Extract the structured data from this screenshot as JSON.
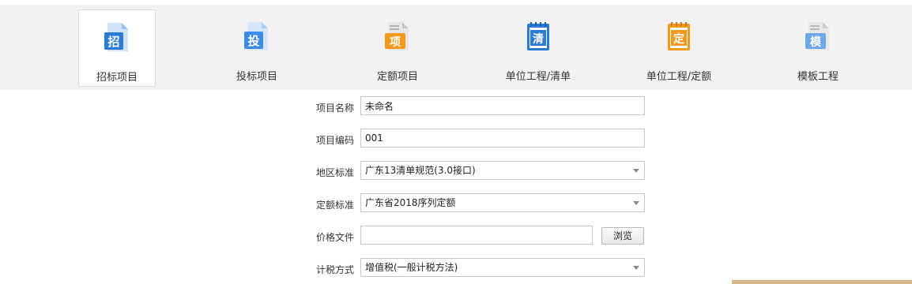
{
  "toolbar": {
    "items": [
      {
        "label": "招标项目",
        "icon_char": "招",
        "icon": "bid-invite-icon",
        "color": "#2a7ad6",
        "active": true
      },
      {
        "label": "投标项目",
        "icon_char": "投",
        "icon": "bid-submit-icon",
        "color": "#3d8be8",
        "active": false
      },
      {
        "label": "定额项目",
        "icon_char": "项",
        "icon": "quota-project-icon",
        "color": "#f39a1e",
        "active": false
      },
      {
        "label": "单位工程/清单",
        "icon_char": "清",
        "icon": "unit-bill-icon",
        "color": "#2a7ad6",
        "active": false
      },
      {
        "label": "单位工程/定额",
        "icon_char": "定",
        "icon": "unit-quota-icon",
        "color": "#f39a1e",
        "active": false
      },
      {
        "label": "模板工程",
        "icon_char": "模",
        "icon": "template-project-icon",
        "color": "#6ea8ea",
        "active": false
      }
    ]
  },
  "form": {
    "project_name": {
      "label": "项目名称",
      "value": "未命名"
    },
    "project_code": {
      "label": "项目编码",
      "value": "001"
    },
    "region_standard": {
      "label": "地区标准",
      "value": "广东13清单规范(3.0接口)"
    },
    "quota_standard": {
      "label": "定额标准",
      "value": "广东省2018序列定额"
    },
    "price_file": {
      "label": "价格文件",
      "value": "",
      "browse_label": "浏览"
    },
    "tax_method": {
      "label": "计税方式",
      "value": "增值税(一般计税方法)"
    }
  }
}
